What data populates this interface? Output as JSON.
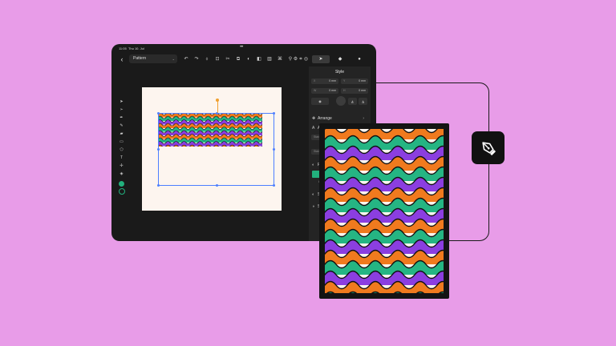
{
  "colors": {
    "background": "#e89ce8",
    "tablet": "#1a1a1a",
    "panel": "#242424",
    "artboard": "#fdf5ef",
    "selection": "#4d7fff",
    "wave_orange": "#f07a1e",
    "wave_green": "#25b583",
    "wave_purple": "#8b3ee0",
    "wave_outline": "#111111",
    "fill_swatch": "#22b07d"
  },
  "status_bar": {
    "time": "11:05",
    "date": "Thu 10. Jul",
    "dots": "•••"
  },
  "toolbar": {
    "back_icon": "chevron-left-icon",
    "document_name": "Pattern",
    "document_chevron": "⌄",
    "actions": [
      {
        "name": "undo-icon",
        "glyph": "↶"
      },
      {
        "name": "redo-icon",
        "glyph": "↷"
      },
      {
        "name": "paint-brush-icon",
        "glyph": "⬨"
      },
      {
        "name": "transform-icon",
        "glyph": "⊡"
      },
      {
        "name": "scissors-icon",
        "glyph": "✂"
      },
      {
        "name": "copy-icon",
        "glyph": "⧉"
      },
      {
        "name": "shape-builder-icon",
        "glyph": "◐"
      },
      {
        "name": "boolean-icon",
        "glyph": "◧"
      },
      {
        "name": "trash-icon",
        "glyph": "▥"
      },
      {
        "name": "link-icon",
        "glyph": "⌘"
      },
      {
        "name": "search-icon",
        "glyph": "⚲"
      },
      {
        "name": "crop-icon",
        "glyph": "⌗"
      }
    ],
    "right_icons": [
      {
        "name": "settings-icon",
        "glyph": "⚙"
      },
      {
        "name": "layers-icon",
        "glyph": "◎"
      }
    ],
    "tabs": [
      {
        "name": "tab-style",
        "glyph": "➤",
        "active": true
      },
      {
        "name": "tab-layers",
        "glyph": "◆",
        "active": false
      },
      {
        "name": "tab-more",
        "glyph": "●",
        "active": false
      }
    ]
  },
  "left_tools": [
    {
      "name": "select-tool-icon",
      "glyph": "➤"
    },
    {
      "name": "direct-select-tool-icon",
      "glyph": "➢"
    },
    {
      "name": "pen-tool-icon",
      "glyph": "✒"
    },
    {
      "name": "pencil-tool-icon",
      "glyph": "✎"
    },
    {
      "name": "brush-tool-icon",
      "glyph": "▰"
    },
    {
      "name": "rectangle-tool-icon",
      "glyph": "▭"
    },
    {
      "name": "shape-tool-icon",
      "glyph": "⬠"
    },
    {
      "name": "text-tool-icon",
      "glyph": "T"
    },
    {
      "name": "gradient-tool-icon",
      "glyph": "✢"
    },
    {
      "name": "eraser-tool-icon",
      "glyph": "◈"
    }
  ],
  "style_panel": {
    "title": "Style",
    "fields": [
      {
        "label": "X",
        "value": "0 mm"
      },
      {
        "label": "Y",
        "value": "0 mm"
      },
      {
        "label": "W",
        "value": "0 mm"
      },
      {
        "label": "H",
        "value": "0 mm"
      }
    ],
    "align_icons": [
      "◉",
      "▣",
      "◭",
      "◮"
    ],
    "arrange_label": "Arrange",
    "arrange_icon": "move-icon",
    "arrange_chevron": "›",
    "sections": [
      {
        "ico": "A",
        "label": "A"
      },
      {
        "ico": "",
        "label": "Stan"
      },
      {
        "ico": "",
        "label": "Stan"
      },
      {
        "ico": "◐",
        "label": "F"
      },
      {
        "ico": "",
        "label": "C"
      },
      {
        "ico": "◐",
        "label": "S"
      },
      {
        "ico": "◑",
        "label": "S"
      }
    ]
  },
  "pen_badge_icon": "pen-nib-icon"
}
